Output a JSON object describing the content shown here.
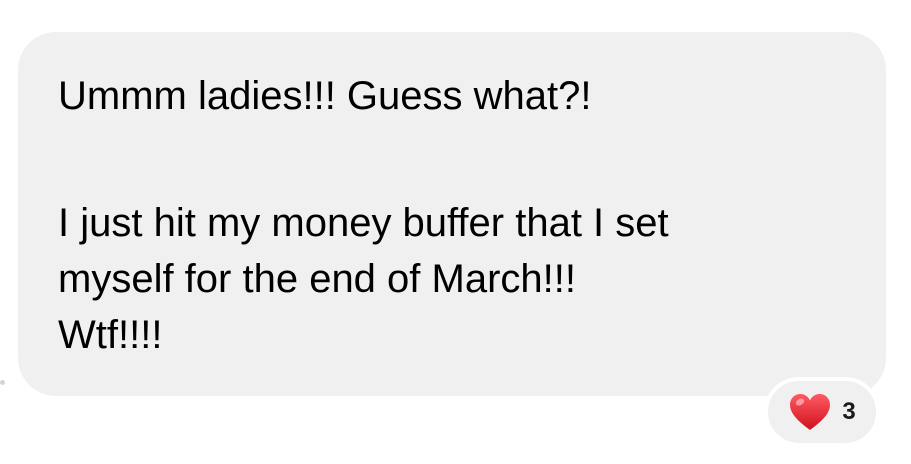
{
  "message": {
    "lines": [
      "Ummm ladies!!! Guess what?!",
      "I just hit my money buffer that I set",
      "myself for the end of March!!!",
      "Wtf!!!!"
    ],
    "bubble_color": "#f0f0f0",
    "text_color": "#000000"
  },
  "reaction": {
    "icon": "heart-icon",
    "count": "3",
    "heart_color": "#e5202e"
  }
}
